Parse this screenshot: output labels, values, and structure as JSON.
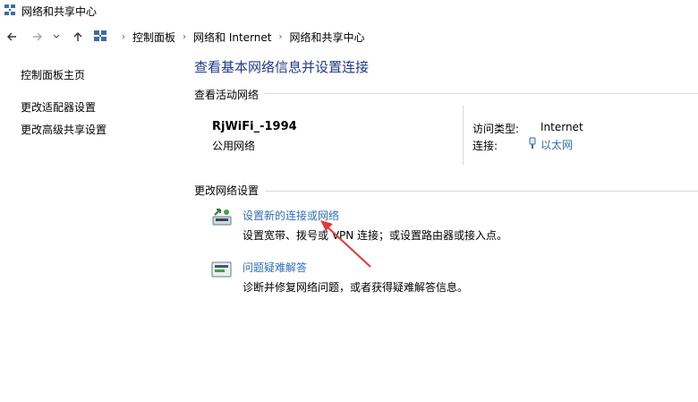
{
  "window": {
    "title": "网络和共享中心",
    "app_icon": "network-center-icon"
  },
  "addressbar": {
    "breadcrumb": [
      "控制面板",
      "网络和 Internet",
      "网络和共享中心"
    ]
  },
  "sidebar": {
    "items": [
      {
        "label": "控制面板主页"
      },
      {
        "label": "更改适配器设置"
      },
      {
        "label": "更改高级共享设置"
      }
    ]
  },
  "main": {
    "title": "查看基本网络信息并设置连接",
    "active_section": "查看活动网络",
    "network": {
      "name": "RjWiFi_-1994",
      "type": "公用网络",
      "access_label": "访问类型:",
      "access_value": "Internet",
      "connection_label": "连接:",
      "connection_value": "以太网",
      "connection_icon": "ethernet-icon"
    },
    "change_section": "更改网络设置",
    "actions": [
      {
        "link": "设置新的连接或网络",
        "desc": "设置宽带、拨号或 VPN 连接；或设置路由器或接入点。",
        "icon": "new-connection-icon"
      },
      {
        "link": "问题疑难解答",
        "desc": "诊断并修复网络问题，或者获得疑难解答信息。",
        "icon": "troubleshoot-icon"
      }
    ]
  },
  "annotation": {
    "arrow_color": "#e53935"
  }
}
